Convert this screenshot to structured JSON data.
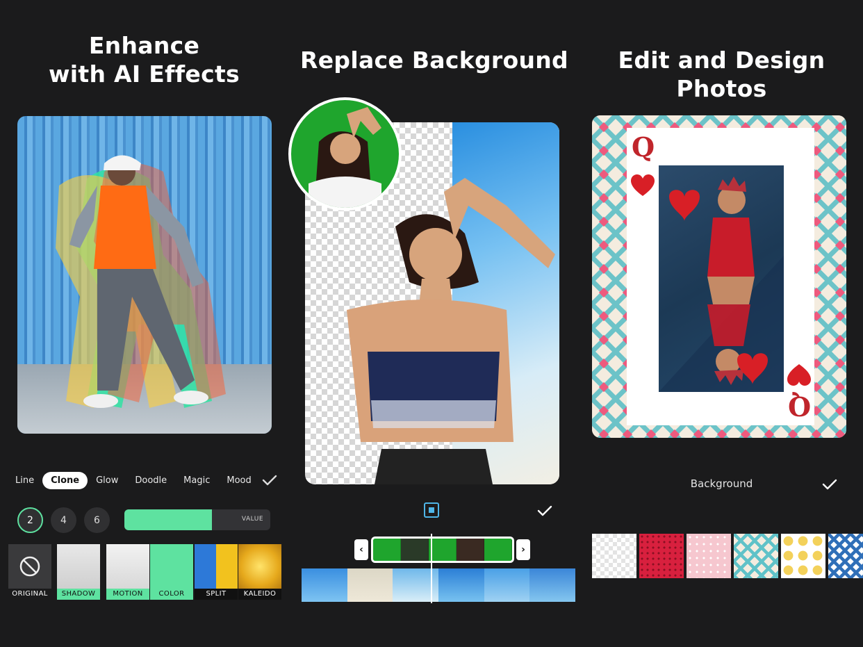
{
  "panel1": {
    "title_line1": "Enhance",
    "title_line2": "with AI Effects",
    "tools": [
      "Line",
      "Clone",
      "Glow",
      "Doodle",
      "Magic",
      "Mood"
    ],
    "active_tool": "Clone",
    "counts": [
      "2",
      "4",
      "6"
    ],
    "active_count": "2",
    "slider_label": "VALUE",
    "slider_value": 0.6,
    "effects": [
      "ORIGINAL",
      "SHADOW",
      "MOTION",
      "COLOR",
      "SPLIT",
      "KALEIDO"
    ],
    "accent": "#5ee2a0"
  },
  "panel2": {
    "title": "Replace Background",
    "accent": "#4fb6e8",
    "left_arrow": "‹",
    "right_arrow": "›"
  },
  "panel3": {
    "title": "Edit and Design Photos",
    "card_rank": "Q",
    "background_label": "Background",
    "swatch_colors": [
      "#f4f4f4",
      "#d8203e",
      "#f6c7cf",
      "#5fc2c8",
      "#f3d15a",
      "#2f6fb8"
    ]
  }
}
